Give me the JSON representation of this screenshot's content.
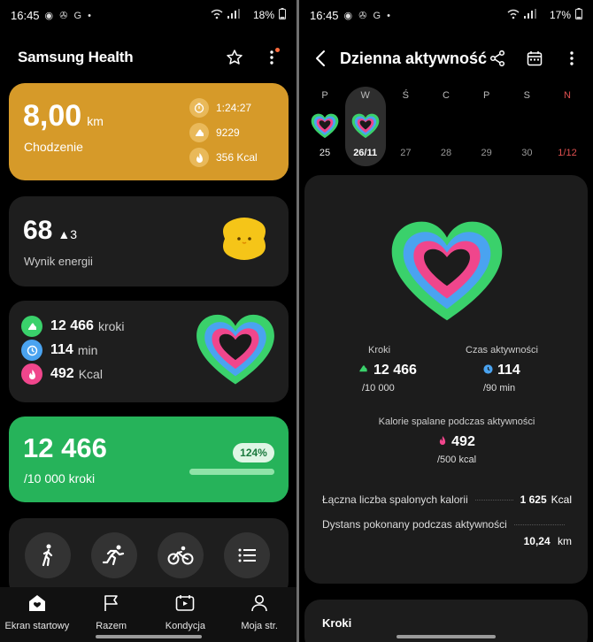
{
  "left": {
    "status": {
      "time": "16:45",
      "icons": "◉ ✇ G •",
      "battery": "18%"
    },
    "header": {
      "title": "Samsung Health"
    },
    "walking": {
      "value": "8,00",
      "unit": "km",
      "label": "Chodzenie",
      "duration": "1:24:27",
      "steps": "9229",
      "calories": "356 Kcal",
      "color": "#d69a29"
    },
    "energy": {
      "score": "68",
      "delta": "▲3",
      "label": "Wynik energii"
    },
    "activity": {
      "steps_value": "12 466",
      "steps_unit": "kroki",
      "minutes_value": "114",
      "minutes_unit": "min",
      "kcal_value": "492",
      "kcal_unit": "Kcal"
    },
    "steps": {
      "value": "12 466",
      "goal": "/10 000 kroki",
      "percent": "124%",
      "progress_fraction": 1.0,
      "color": "#26b35a"
    },
    "exercise_buttons": [
      "walk-icon",
      "run-icon",
      "bike-icon",
      "list-icon"
    ],
    "nav": [
      {
        "label": "Ekran startowy",
        "icon": "home-icon"
      },
      {
        "label": "Razem",
        "icon": "flag-icon"
      },
      {
        "label": "Kondycja",
        "icon": "fitness-icon"
      },
      {
        "label": "Moja str.",
        "icon": "person-icon"
      }
    ]
  },
  "right": {
    "status": {
      "time": "16:45",
      "icons": "◉ ✇ G •",
      "battery": "17%"
    },
    "header": {
      "title": "Dzienna aktywność"
    },
    "week": [
      {
        "day": "P",
        "date": "25",
        "has": true
      },
      {
        "day": "W",
        "date": "26/11",
        "has": true,
        "selected": true
      },
      {
        "day": "Ś",
        "date": "27",
        "has": false
      },
      {
        "day": "C",
        "date": "28",
        "has": false
      },
      {
        "day": "P",
        "date": "29",
        "has": false
      },
      {
        "day": "S",
        "date": "30",
        "has": false
      },
      {
        "day": "N",
        "date": "1/12",
        "has": false,
        "sunday": true
      }
    ],
    "metrics": {
      "steps_label": "Kroki",
      "steps_value": "12 466",
      "steps_goal": "/10 000",
      "active_label": "Czas aktywności",
      "active_value": "114",
      "active_goal": "/90 min",
      "kcal_label": "Kalorie spalane podczas aktywności",
      "kcal_value": "492",
      "kcal_goal": "/500 kcal"
    },
    "totals": {
      "burned_label": "Łączna liczba spalonych kalorii",
      "burned_value": "1 625",
      "burned_unit": "Kcal",
      "distance_label": "Dystans pokonany podczas aktywności",
      "distance_value": "10,24",
      "distance_unit": "km"
    },
    "steps_section": {
      "title": "Kroki"
    }
  },
  "colors": {
    "ring_green": "#3ad16b",
    "ring_blue": "#4aa3f0",
    "ring_pink": "#f0468c",
    "ring_dark": "#1a1a1a"
  }
}
